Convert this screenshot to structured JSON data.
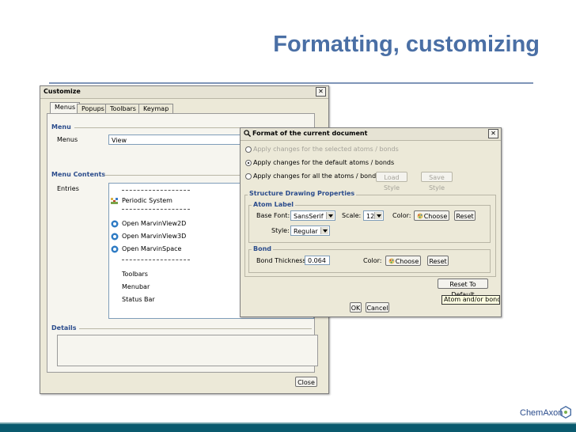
{
  "slide": {
    "title": "Formatting, customizing"
  },
  "customize": {
    "title": "Customize",
    "close_x": "✕",
    "tabs": [
      "Menus",
      "Popups",
      "Toolbars",
      "Keymap"
    ],
    "menu_section": "Menu",
    "menus_label": "Menus",
    "menus_value": "View",
    "menu_contents_section": "Menu Contents",
    "entries_label": "Entries",
    "entries": [
      {
        "kind": "sep"
      },
      {
        "kind": "item",
        "label": "Periodic System",
        "icon": "periodic-table-icon"
      },
      {
        "kind": "sep"
      },
      {
        "kind": "item",
        "label": "Open MarvinView2D",
        "icon": "marvin-icon"
      },
      {
        "kind": "item",
        "label": "Open MarvinView3D",
        "icon": "marvin-icon"
      },
      {
        "kind": "item",
        "label": "Open MarvinSpace",
        "icon": "marvin-icon"
      },
      {
        "kind": "sep"
      },
      {
        "kind": "item",
        "label": "Toolbars"
      },
      {
        "kind": "item",
        "label": "Menubar"
      },
      {
        "kind": "item",
        "label": "Status Bar"
      }
    ],
    "details_section": "Details",
    "close_button": "Close"
  },
  "format": {
    "title": "Format of the current document",
    "close_x": "✕",
    "radio_selected": "Apply changes for the selected atoms / bonds",
    "radio_default": "Apply changes for the default atoms / bonds",
    "radio_all": "Apply changes for all the atoms / bonds",
    "load_style": "Load Style",
    "save_style": "Save Style",
    "structure_group": "Structure Drawing Properties",
    "atom_label_group": "Atom Label",
    "base_font_label": "Base Font:",
    "base_font_value": "SansSerif",
    "scale_label": "Scale:",
    "scale_value": "12",
    "color_label": "Color:",
    "choose": "Choose",
    "reset": "Reset",
    "style_label": "Style:",
    "style_value": "Regular",
    "bond_group": "Bond",
    "bond_thickness_label": "Bond Thickness:",
    "bond_thickness_value": "0.064",
    "bond_color_label": "Color:",
    "reset_default": "Reset To Default",
    "ok": "OK",
    "cancel": "Cancel",
    "tooltip": "Atom and/or bond dra"
  },
  "footer": {
    "logo": "ChemAxon"
  },
  "colors": {
    "title": "#4a6fa5",
    "band": "#0a5a6e"
  }
}
